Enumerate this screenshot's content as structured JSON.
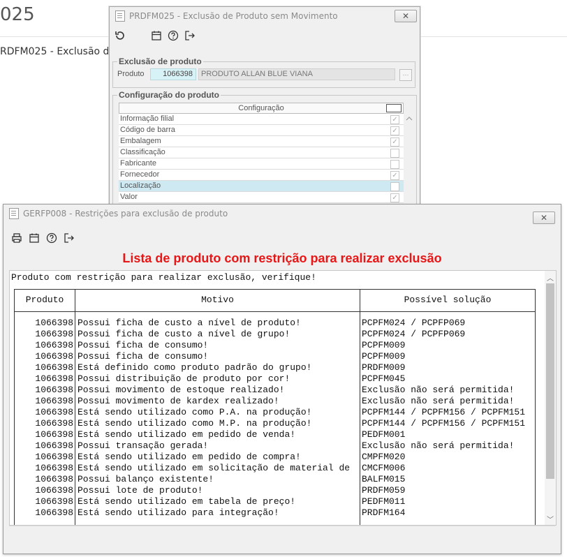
{
  "background": {
    "title": "025",
    "subtitle": "RDFM025 - Exclusão d"
  },
  "back_window": {
    "title": "PRDFM025 - Exclusão de Produto sem Movimento",
    "close_label": "✕",
    "group1_label": "Exclusão de produto",
    "field_label": "Produto",
    "product_code": "1066398",
    "product_name": "PRODUTO ALLAN BLUE VIANA",
    "group2_label": "Configuração do produto",
    "config_header": "Configuração",
    "config_items": [
      {
        "label": "Informação filial",
        "checked": true
      },
      {
        "label": "Código de barra",
        "checked": true
      },
      {
        "label": "Embalagem",
        "checked": true
      },
      {
        "label": "Classificação",
        "checked": false
      },
      {
        "label": "Fabricante",
        "checked": false
      },
      {
        "label": "Fornecedor",
        "checked": true
      },
      {
        "label": "Localização",
        "checked": false
      },
      {
        "label": "Valor",
        "checked": true
      }
    ]
  },
  "front_window": {
    "title": "GERFP008 - Restrições para exclusão de produto",
    "close_label": "✕",
    "banner": "Lista de produto com restrição para realizar exclusão",
    "intro": "Produto com restrição para realizar exclusão, verifique!",
    "columns": {
      "produto": "Produto",
      "motivo": "Motivo",
      "solucao": "Possível solução"
    },
    "rows": [
      {
        "produto": "1066398",
        "motivo": "Possui ficha de custo a nível de produto!",
        "solucao": "PCPFM024 / PCPFP069"
      },
      {
        "produto": "1066398",
        "motivo": "Possui ficha de custo a nível de grupo!",
        "solucao": "PCPFM024 / PCPFP069"
      },
      {
        "produto": "1066398",
        "motivo": "Possui ficha de consumo!",
        "solucao": "PCPFM009"
      },
      {
        "produto": "1066398",
        "motivo": "Possui ficha de consumo!",
        "solucao": "PCPFM009"
      },
      {
        "produto": "1066398",
        "motivo": "Está definido como produto padrão do grupo!",
        "solucao": "PRDFM009"
      },
      {
        "produto": "1066398",
        "motivo": "Possui distribuição de produto por cor!",
        "solucao": "PCPFM045"
      },
      {
        "produto": "1066398",
        "motivo": "Possui movimento de estoque realizado!",
        "solucao": "Exclusão não será permitida!"
      },
      {
        "produto": "1066398",
        "motivo": "Possui movimento de kardex realizado!",
        "solucao": "Exclusão não será permitida!"
      },
      {
        "produto": "1066398",
        "motivo": "Está sendo utilizado como P.A. na produção!",
        "solucao": "PCPFM144 / PCPFM156 / PCPFM151"
      },
      {
        "produto": "1066398",
        "motivo": "Está sendo utilizado como M.P. na produção!",
        "solucao": "PCPFM144 / PCPFM156 / PCPFM151"
      },
      {
        "produto": "1066398",
        "motivo": "Está sendo utilizado em pedido de venda!",
        "solucao": "PEDFM001"
      },
      {
        "produto": "1066398",
        "motivo": "Possui transação gerada!",
        "solucao": "Exclusão não será permitida!"
      },
      {
        "produto": "1066398",
        "motivo": "Está sendo utilizado em pedido de compra!",
        "solucao": "CMPFM020"
      },
      {
        "produto": "1066398",
        "motivo": "Está sendo utilizado em solicitação de material de",
        "solucao": "CMCFM006"
      },
      {
        "produto": "1066398",
        "motivo": "Possui balanço existente!",
        "solucao": "BALFM015"
      },
      {
        "produto": "1066398",
        "motivo": "Possui lote de produto!",
        "solucao": "PRDFM059"
      },
      {
        "produto": "1066398",
        "motivo": "Está sendo utilizado em tabela de preço!",
        "solucao": "PEDFM011"
      },
      {
        "produto": "1066398",
        "motivo": "Está sendo utilizado para integração!",
        "solucao": "PRDFM164"
      }
    ]
  },
  "colors": {
    "banner": "#e81616",
    "code_bg": "#d8f3f8",
    "selected_row": "#cfe9f2"
  }
}
